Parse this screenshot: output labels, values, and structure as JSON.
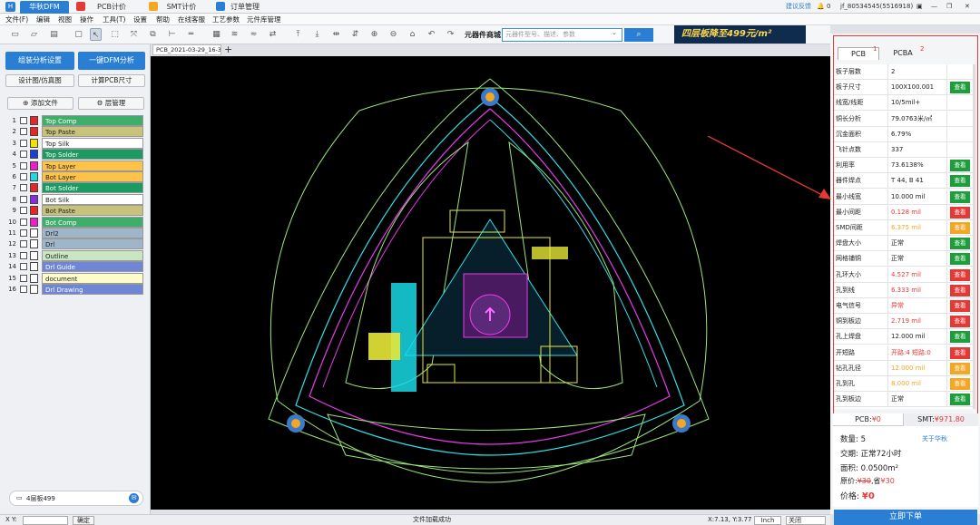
{
  "app": {
    "tabs": [
      {
        "label": "华秋DFM",
        "active": true
      },
      {
        "label": "PCB计价"
      },
      {
        "label": "SMT计价"
      },
      {
        "label": "订单管理"
      }
    ],
    "feedback": "建议反馈",
    "notif_count": "0",
    "user": "jf_80534545(5516918)"
  },
  "menu": [
    "文件(F)",
    "编辑",
    "视图",
    "操作",
    "工具(T)",
    "设置",
    "帮助",
    "在线客服",
    "工艺参数",
    "元件库管理"
  ],
  "toolbar": {
    "mall_label": "元器件商城",
    "search_placeholder": "元器件型号、描述、参数",
    "banner_text": "四层板降至499元/m²"
  },
  "left": {
    "btn_assembly": "组装分析设置",
    "btn_dfm": "一键DFM分析",
    "btn_sim": "设计图/仿真图",
    "btn_calc": "计算PCB尺寸",
    "btn_add": "添加文件",
    "btn_layers": "层管理",
    "layers": [
      {
        "num": "1",
        "name": "Top Comp",
        "swatch": "#e8262a",
        "bg": "#3fae6a",
        "color": "#ffffff"
      },
      {
        "num": "2",
        "name": "Top Paste",
        "swatch": "#e8262a",
        "bg": "#c9c27a",
        "color": "#222222"
      },
      {
        "num": "3",
        "name": "Top Silk",
        "swatch": "#f2e400",
        "bg": "#ffffff",
        "color": "#222222"
      },
      {
        "num": "4",
        "name": "Top Solder",
        "swatch": "#1a3fd6",
        "bg": "#1b9b61",
        "color": "#ffffff"
      },
      {
        "num": "5",
        "name": "Top Layer",
        "swatch": "#ef1ec8",
        "bg": "#fdc24a",
        "color": "#222222"
      },
      {
        "num": "6",
        "name": "Bot Layer",
        "swatch": "#22d7e0",
        "bg": "#fdc24a",
        "color": "#222222"
      },
      {
        "num": "7",
        "name": "Bot Solder",
        "swatch": "#e8262a",
        "bg": "#1b9b61",
        "color": "#ffffff"
      },
      {
        "num": "8",
        "name": "Bot Silk",
        "swatch": "#8a2be2",
        "bg": "#ffffff",
        "color": "#222222"
      },
      {
        "num": "9",
        "name": "Bot Paste",
        "swatch": "#e8262a",
        "bg": "#c9c27a",
        "color": "#222222"
      },
      {
        "num": "10",
        "name": "Bot Comp",
        "swatch": "#ef1ec8",
        "bg": "#3fae6a",
        "color": "#ffffff"
      },
      {
        "num": "11",
        "name": "Drl2",
        "swatch": "#ffffff",
        "bg": "#9fb6c9",
        "color": "#222222"
      },
      {
        "num": "12",
        "name": "Drl",
        "swatch": "#ffffff",
        "bg": "#9fb6c9",
        "color": "#222222"
      },
      {
        "num": "13",
        "name": "Outline",
        "swatch": "#ffffff",
        "bg": "#c8e6c0",
        "color": "#222222"
      },
      {
        "num": "14",
        "name": "Drl Guide",
        "swatch": "#ffffff",
        "bg": "#6f86d6",
        "color": "#ffffff"
      },
      {
        "num": "15",
        "name": "document",
        "swatch": "#ffffff",
        "bg": "#fffccc",
        "color": "#222222"
      },
      {
        "num": "16",
        "name": "Drl Drawing",
        "swatch": "#ffffff",
        "bg": "#6f86d6",
        "color": "#ffffff"
      }
    ],
    "chat_text": "4层板499"
  },
  "doc": {
    "tab": "PCB_2021-03-29_16-3..."
  },
  "right": {
    "tabs": [
      {
        "label": "PCB",
        "num": "1"
      },
      {
        "label": "PCBA",
        "num": "2"
      }
    ],
    "rows": [
      {
        "label": "板子层数",
        "value": "2",
        "vcolor": "#222222"
      },
      {
        "label": "板子尺寸",
        "value": "100X100.001",
        "vcolor": "#222222",
        "btn": "查看",
        "btncolor": "#1e9e3a"
      },
      {
        "label": "线宽/线距",
        "value": "10/5mil+",
        "vcolor": "#222222"
      },
      {
        "label": "铜长分析",
        "value": "79.0763米/㎡",
        "vcolor": "#222222"
      },
      {
        "label": "沉金面积",
        "value": "6.79%",
        "vcolor": "#222222"
      },
      {
        "label": "飞针点数",
        "value": "337",
        "vcolor": "#222222"
      },
      {
        "label": "利用率",
        "value": "73.6138%",
        "vcolor": "#222222",
        "btn": "查看",
        "btncolor": "#1e9e3a"
      },
      {
        "label": "器件焊点",
        "value": "T 44, B 41",
        "vcolor": "#222222",
        "btn": "查看",
        "btncolor": "#1e9e3a"
      },
      {
        "label": "最小线宽",
        "value": "10.000 mil",
        "vcolor": "#222222",
        "btn": "查看",
        "btncolor": "#1e9e3a"
      },
      {
        "label": "最小间距",
        "value": "0.128 mil",
        "vcolor": "#e53935",
        "btn": "查看",
        "btncolor": "#e53935"
      },
      {
        "label": "SMD间距",
        "value": "6.375 mil",
        "vcolor": "#f5a623",
        "btn": "查看",
        "btncolor": "#f5a623"
      },
      {
        "label": "焊盘大小",
        "value": "正常",
        "vcolor": "#222222",
        "btn": "查看",
        "btncolor": "#1e9e3a"
      },
      {
        "label": "网格铺铜",
        "value": "正常",
        "vcolor": "#222222",
        "btn": "查看",
        "btncolor": "#1e9e3a"
      },
      {
        "label": "孔环大小",
        "value": "4.527 mil",
        "vcolor": "#e53935",
        "btn": "查看",
        "btncolor": "#e53935"
      },
      {
        "label": "孔到线",
        "value": "6.333 mil",
        "vcolor": "#e53935",
        "btn": "查看",
        "btncolor": "#e53935"
      },
      {
        "label": "电气信号",
        "value": "异常",
        "vcolor": "#e53935",
        "btn": "查看",
        "btncolor": "#e53935"
      },
      {
        "label": "铜到板边",
        "value": "2.719 mil",
        "vcolor": "#e53935",
        "btn": "查看",
        "btncolor": "#e53935"
      },
      {
        "label": "孔上焊盘",
        "value": "12.000 mil",
        "vcolor": "#222222",
        "btn": "查看",
        "btncolor": "#1e9e3a"
      },
      {
        "label": "开短路",
        "value": "开路:4 短路:0",
        "vcolor": "#e53935",
        "btn": "查看",
        "btncolor": "#e53935"
      },
      {
        "label": "钻孔孔径",
        "value": "12.000 mil",
        "vcolor": "#f5a623",
        "btn": "查看",
        "btncolor": "#f5a623"
      },
      {
        "label": "孔到孔",
        "value": "8.000 mil",
        "vcolor": "#f5a623",
        "btn": "查看",
        "btncolor": "#f5a623"
      },
      {
        "label": "孔到板边",
        "value": "正常",
        "vcolor": "#222222",
        "btn": "查看",
        "btncolor": "#1e9e3a"
      }
    ],
    "price_tabs": [
      {
        "label": "PCB:",
        "value": "¥0"
      },
      {
        "label": "SMT:",
        "value": "¥971.80"
      }
    ],
    "qty_label": "数量:",
    "qty": "5",
    "about": "关于华秋",
    "lead_label": "交期:",
    "lead": "正常72小时",
    "area_label": "面积:",
    "area": "0.0500m²",
    "orig_label": "原价:",
    "orig": "¥30",
    "save_label": ",省",
    "save": "¥30",
    "price_label": "价格:",
    "price": "¥0",
    "order_btn": "立即下单"
  },
  "status": {
    "xy_label": "X Y:",
    "ok_btn": "确定",
    "msg": "文件加载成功",
    "coords": "X:7.13, Y:3.77",
    "unit": "Inch",
    "snap": "关闭"
  }
}
